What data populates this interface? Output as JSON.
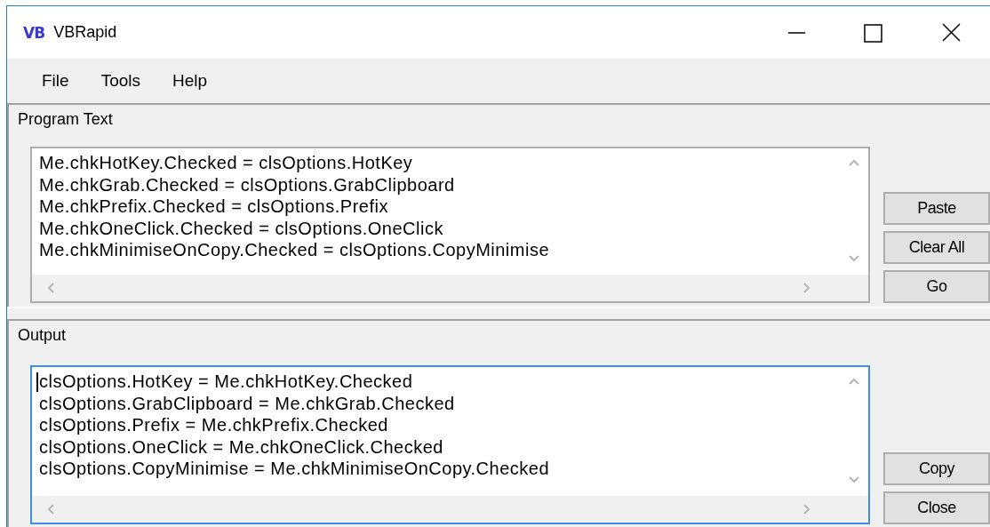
{
  "window": {
    "logo": "VB",
    "title": "VBRapid"
  },
  "menu": [
    "File",
    "Tools",
    "Help"
  ],
  "panels": [
    {
      "title": "Program Text",
      "focused": false,
      "lines": [
        "Me.chkHotKey.Checked = clsOptions.HotKey",
        "Me.chkGrab.Checked = clsOptions.GrabClipboard",
        "Me.chkPrefix.Checked = clsOptions.Prefix",
        "Me.chkOneClick.Checked = clsOptions.OneClick",
        "Me.chkMinimiseOnCopy.Checked = clsOptions.CopyMinimise"
      ],
      "buttons": [
        "Paste",
        "Clear All",
        "Go"
      ]
    },
    {
      "title": "Output",
      "focused": true,
      "lines": [
        "clsOptions.HotKey = Me.chkHotKey.Checked",
        "clsOptions.GrabClipboard = Me.chkGrab.Checked",
        "clsOptions.Prefix = Me.chkPrefix.Checked",
        "clsOptions.OneClick = Me.chkOneClick.Checked",
        "clsOptions.CopyMinimise = Me.chkMinimiseOnCopy.Checked"
      ],
      "buttons": [
        "Copy",
        "Close"
      ]
    }
  ]
}
